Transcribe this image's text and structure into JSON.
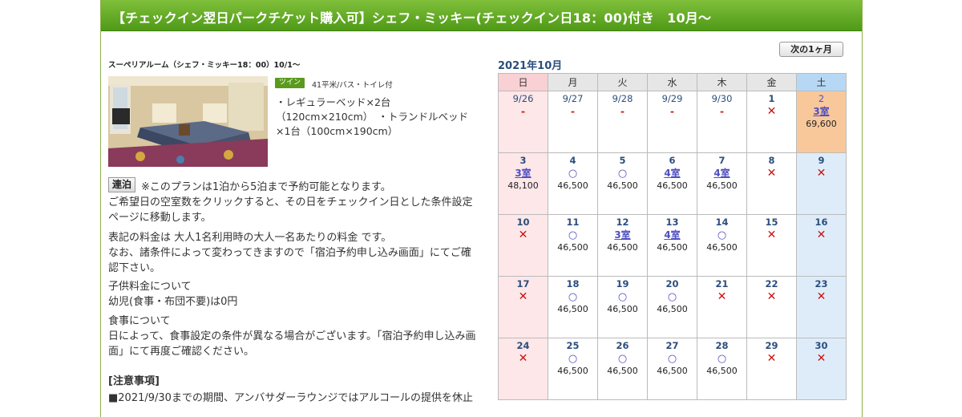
{
  "header": {
    "title": "【チェックイン翌日パークチケット購入可】シェフ・ミッキー(チェックイン日18：00)付き　10月〜"
  },
  "nav": {
    "next_month_label": "次の1ヶ月"
  },
  "room": {
    "name": "スーペリアルーム（シェフ・ミッキー18：00）10/1〜",
    "type_badge": "ツイン",
    "size": "41平米/バス・トイレ付",
    "beds": "・レギュラーベッド×2台（120cm×210cm）　・トランドルベッド×1台（100cm×190cm）"
  },
  "plan": {
    "renpaku_label": "連泊",
    "renpaku_note": "※このプランは1泊から5泊まで予約可能となります。",
    "click_note": "ご希望日の空室数をクリックすると、その日をチェックイン日とした条件設定ページに移動します。",
    "price_note_1": "表記の料金は 大人1名利用時の大人一名あたりの料金 です。",
    "price_note_2": "なお、諸条件によって変わってきますので「宿泊予約申し込み画面」にてご確認下さい。",
    "child_title": "子供料金について",
    "child_text": "幼児(食事・布団不要)は0円",
    "meal_title": "食事について",
    "meal_text": "日によって、食事設定の条件が異なる場合がございます。「宿泊予約申し込み画面」にて再度ご確認ください。",
    "notice_title": "[注意事項]",
    "notice_text": "■2021/9/30までの期間、アンバサダーラウンジではアルコールの提供を休止"
  },
  "calendar": {
    "month_title": "2021年10月",
    "weekdays": [
      "日",
      "月",
      "火",
      "水",
      "木",
      "金",
      "土"
    ],
    "weeks": [
      [
        {
          "day": "9/26",
          "status": "-",
          "kind": "dash",
          "price": "",
          "past": true
        },
        {
          "day": "9/27",
          "status": "-",
          "kind": "dash",
          "price": "",
          "past": true
        },
        {
          "day": "9/28",
          "status": "-",
          "kind": "dash",
          "price": "",
          "past": true
        },
        {
          "day": "9/29",
          "status": "-",
          "kind": "dash",
          "price": "",
          "past": true
        },
        {
          "day": "9/30",
          "status": "-",
          "kind": "dash",
          "price": "",
          "past": true
        },
        {
          "day": "1",
          "status": "✕",
          "kind": "x",
          "price": ""
        },
        {
          "day": "2",
          "status": "3室",
          "kind": "rooms",
          "price": "69,600",
          "selected": true
        }
      ],
      [
        {
          "day": "3",
          "status": "3室",
          "kind": "rooms",
          "price": "48,100"
        },
        {
          "day": "4",
          "status": "○",
          "kind": "circle",
          "price": "46,500"
        },
        {
          "day": "5",
          "status": "○",
          "kind": "circle",
          "price": "46,500"
        },
        {
          "day": "6",
          "status": "4室",
          "kind": "rooms",
          "price": "46,500"
        },
        {
          "day": "7",
          "status": "4室",
          "kind": "rooms",
          "price": "46,500"
        },
        {
          "day": "8",
          "status": "✕",
          "kind": "x",
          "price": ""
        },
        {
          "day": "9",
          "status": "✕",
          "kind": "x",
          "price": ""
        }
      ],
      [
        {
          "day": "10",
          "status": "✕",
          "kind": "x",
          "price": ""
        },
        {
          "day": "11",
          "status": "○",
          "kind": "circle",
          "price": "46,500"
        },
        {
          "day": "12",
          "status": "3室",
          "kind": "rooms",
          "price": "46,500"
        },
        {
          "day": "13",
          "status": "4室",
          "kind": "rooms",
          "price": "46,500"
        },
        {
          "day": "14",
          "status": "○",
          "kind": "circle",
          "price": "46,500"
        },
        {
          "day": "15",
          "status": "✕",
          "kind": "x",
          "price": ""
        },
        {
          "day": "16",
          "status": "✕",
          "kind": "x",
          "price": ""
        }
      ],
      [
        {
          "day": "17",
          "status": "✕",
          "kind": "x",
          "price": ""
        },
        {
          "day": "18",
          "status": "○",
          "kind": "circle",
          "price": "46,500"
        },
        {
          "day": "19",
          "status": "○",
          "kind": "circle",
          "price": "46,500"
        },
        {
          "day": "20",
          "status": "○",
          "kind": "circle",
          "price": "46,500"
        },
        {
          "day": "21",
          "status": "✕",
          "kind": "x",
          "price": ""
        },
        {
          "day": "22",
          "status": "✕",
          "kind": "x",
          "price": ""
        },
        {
          "day": "23",
          "status": "✕",
          "kind": "x",
          "price": ""
        }
      ],
      [
        {
          "day": "24",
          "status": "✕",
          "kind": "x",
          "price": ""
        },
        {
          "day": "25",
          "status": "○",
          "kind": "circle",
          "price": "46,500"
        },
        {
          "day": "26",
          "status": "○",
          "kind": "circle",
          "price": "46,500"
        },
        {
          "day": "27",
          "status": "○",
          "kind": "circle",
          "price": "46,500"
        },
        {
          "day": "28",
          "status": "○",
          "kind": "circle",
          "price": "46,500"
        },
        {
          "day": "29",
          "status": "✕",
          "kind": "x",
          "price": ""
        },
        {
          "day": "30",
          "status": "✕",
          "kind": "x",
          "price": ""
        }
      ]
    ]
  }
}
